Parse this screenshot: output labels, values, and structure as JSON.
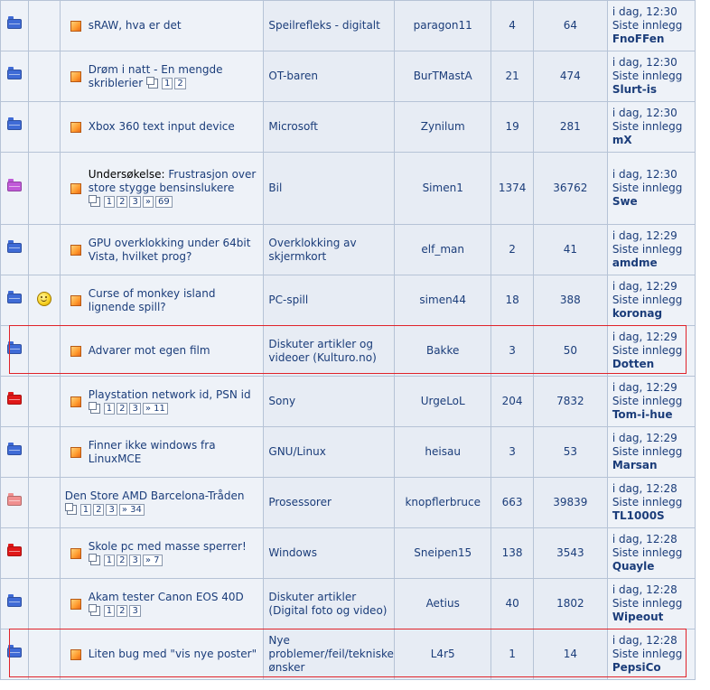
{
  "colors": {
    "folder_blue": "#3f6bd6",
    "folder_purple": "#c05ad8",
    "folder_red": "#e01818",
    "folder_pink": "#f09090",
    "highlight": "#e0232a"
  },
  "last_label": "Siste innlegg",
  "rows": [
    {
      "folder": "blue",
      "smiley": false,
      "posticon": true,
      "prefix": "",
      "title": "sRAW, hva er det",
      "pages": [],
      "forum": "Speilrefleks - digitalt",
      "author": "paragon11",
      "replies": "4",
      "views": "64",
      "last_time": "i dag, 12:30",
      "last_user": "FnoFFen",
      "h": 55
    },
    {
      "folder": "blue",
      "smiley": false,
      "posticon": true,
      "prefix": "",
      "title": "Drøm i natt - En mengde skriblerier",
      "pages": [
        "1",
        "2"
      ],
      "forum": "OT-baren",
      "author": "BurTMastA",
      "replies": "21",
      "views": "474",
      "last_time": "i dag, 12:30",
      "last_user": "Slurt-is",
      "h": 55
    },
    {
      "folder": "blue",
      "smiley": false,
      "posticon": true,
      "prefix": "",
      "title": "Xbox 360 text input device",
      "pages": [],
      "forum": "Microsoft",
      "author": "Zynilum",
      "replies": "19",
      "views": "281",
      "last_time": "i dag, 12:30",
      "last_user": "mX",
      "h": 55
    },
    {
      "folder": "purple",
      "smiley": false,
      "posticon": true,
      "prefix": "Undersøkelse:",
      "title": "Frustrasjon over store stygge bensinslukere",
      "pages": [
        "1",
        "2",
        "3",
        "»"
      ],
      "pages_tail": "69",
      "forum": "Bil",
      "author": "Simen1",
      "replies": "1374",
      "views": "36762",
      "last_time": "i dag, 12:30",
      "last_user": "Swe",
      "h": 79
    },
    {
      "folder": "blue",
      "smiley": false,
      "posticon": true,
      "prefix": "",
      "title": "GPU overklokking under 64bit Vista, hvilket prog?",
      "pages": [],
      "forum": "Overklokking av skjermkort",
      "author": "elf_man",
      "replies": "2",
      "views": "41",
      "last_time": "i dag, 12:29",
      "last_user": "amdme",
      "h": 55
    },
    {
      "folder": "blue",
      "smiley": true,
      "posticon": true,
      "prefix": "",
      "title": "Curse of monkey island lignende spill?",
      "pages": [],
      "forum": "PC-spill",
      "author": "simen44",
      "replies": "18",
      "views": "388",
      "last_time": "i dag, 12:29",
      "last_user": "koronag",
      "h": 55
    },
    {
      "folder": "blue",
      "smiley": false,
      "posticon": true,
      "prefix": "",
      "title": "Advarer mot egen film",
      "pages": [],
      "forum": "Diskuter artikler og videoer (Kulturo.no)",
      "author": "Bakke",
      "replies": "3",
      "views": "50",
      "last_time": "i dag, 12:29",
      "last_user": "Dotten",
      "h": 55
    },
    {
      "folder": "red",
      "smiley": false,
      "posticon": true,
      "prefix": "",
      "title": "Playstation network id, PSN id",
      "pages": [
        "1",
        "2",
        "3",
        "» 11"
      ],
      "forum": "Sony",
      "author": "UrgeLoL",
      "replies": "204",
      "views": "7832",
      "last_time": "i dag, 12:29",
      "last_user": "Tom-i-hue",
      "h": 55
    },
    {
      "folder": "blue",
      "smiley": false,
      "posticon": true,
      "prefix": "",
      "title": "Finner ikke windows fra LinuxMCE",
      "pages": [],
      "forum": "GNU/Linux",
      "author": "heisau",
      "replies": "3",
      "views": "53",
      "last_time": "i dag, 12:29",
      "last_user": "Marsan",
      "h": 55
    },
    {
      "folder": "pink",
      "smiley": false,
      "posticon": false,
      "prefix": "",
      "title": "Den Store AMD Barcelona-Tråden",
      "pages": [
        "1",
        "2",
        "3",
        "» 34"
      ],
      "forum": "Prosessorer",
      "author": "knopflerbruce",
      "replies": "663",
      "views": "39839",
      "last_time": "i dag, 12:28",
      "last_user": "TL1000S",
      "h": 55
    },
    {
      "folder": "red",
      "smiley": false,
      "posticon": true,
      "prefix": "",
      "title": "Skole pc med masse sperrer!",
      "pages": [
        "1",
        "2",
        "3",
        "» 7"
      ],
      "forum": "Windows",
      "author": "Sneipen15",
      "replies": "138",
      "views": "3543",
      "last_time": "i dag, 12:28",
      "last_user": "Quayle",
      "h": 55
    },
    {
      "folder": "blue",
      "smiley": false,
      "posticon": true,
      "prefix": "",
      "title": "Akam tester Canon EOS 40D",
      "pages": [
        "1",
        "2",
        "3"
      ],
      "forum": "Diskuter artikler (Digital foto og video)",
      "author": "Aetius",
      "replies": "40",
      "views": "1802",
      "last_time": "i dag, 12:28",
      "last_user": "Wipeout",
      "h": 55
    },
    {
      "folder": "blue",
      "smiley": false,
      "posticon": true,
      "prefix": "",
      "title": "Liten bug med \"vis nye poster\"",
      "pages": [],
      "forum": "Nye problemer/feil/tekniske ønsker",
      "author": "L4r5",
      "replies": "1",
      "views": "14",
      "last_time": "i dag, 12:28",
      "last_user": "PepsiCo",
      "h": 55
    }
  ],
  "highlighted_rows": [
    6,
    12
  ]
}
